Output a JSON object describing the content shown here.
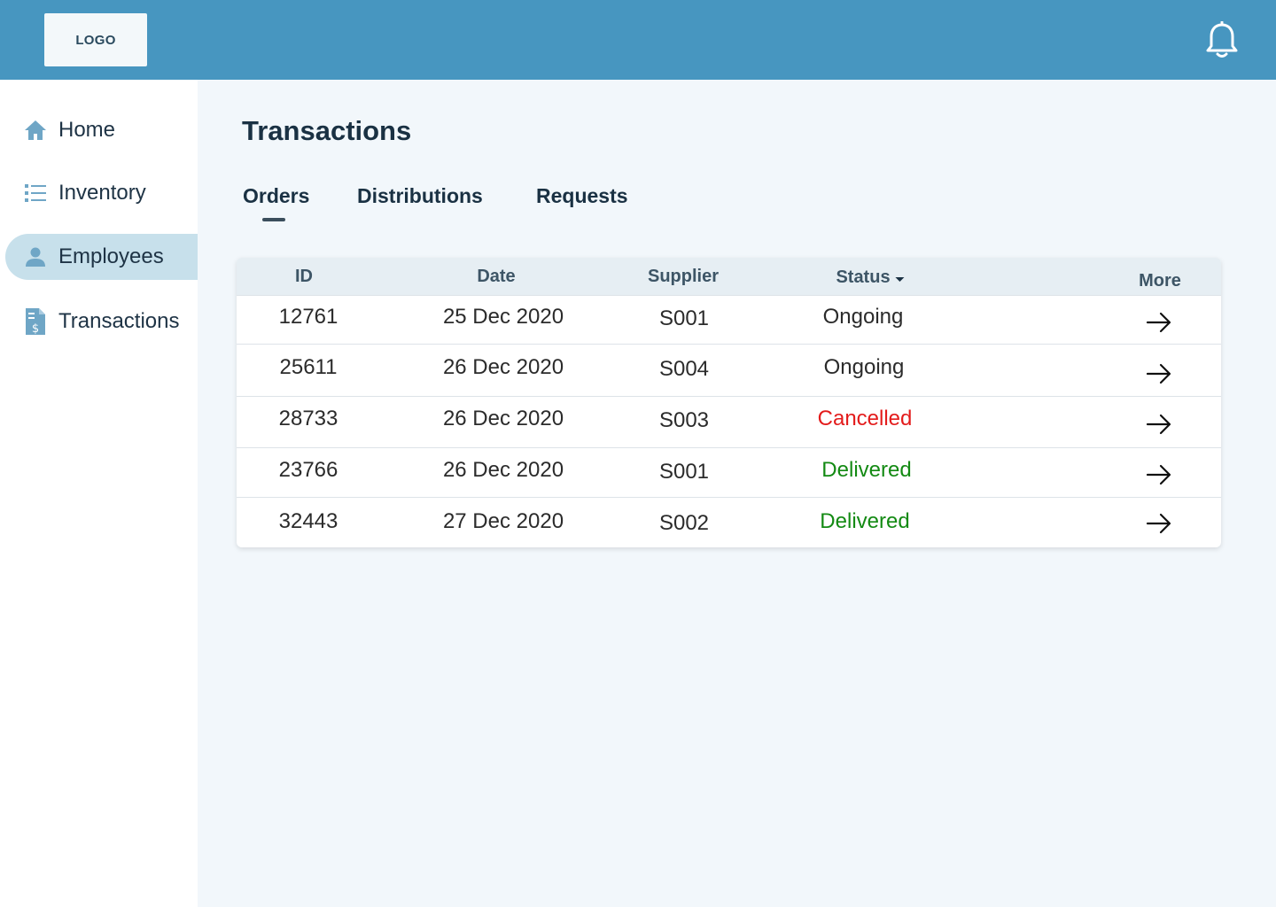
{
  "header": {
    "logo_text": "LOGO",
    "notification_icon": "bell-icon"
  },
  "sidebar": {
    "items": [
      {
        "label": "Home",
        "icon": "home-icon",
        "active": false
      },
      {
        "label": "Inventory",
        "icon": "list-icon",
        "active": false
      },
      {
        "label": "Employees",
        "icon": "person-icon",
        "active": true
      },
      {
        "label": "Transactions",
        "icon": "invoice-icon",
        "active": false
      }
    ]
  },
  "main": {
    "title": "Transactions",
    "tabs": [
      {
        "label": "Orders",
        "active": true
      },
      {
        "label": "Distributions",
        "active": false
      },
      {
        "label": "Requests",
        "active": false
      }
    ],
    "table": {
      "columns": {
        "id": "ID",
        "date": "Date",
        "supplier": "Supplier",
        "status": "Status",
        "more": "More"
      },
      "rows": [
        {
          "id": "12761",
          "date": "25 Dec 2020",
          "supplier": "S001",
          "status": "Ongoing"
        },
        {
          "id": "25611",
          "date": "26 Dec 2020",
          "supplier": "S004",
          "status": "Ongoing"
        },
        {
          "id": "28733",
          "date": "26 Dec 2020",
          "supplier": "S003",
          "status": "Cancelled"
        },
        {
          "id": "23766",
          "date": "26 Dec 2020",
          "supplier": "S001",
          "status": "Delivered"
        },
        {
          "id": "32443",
          "date": "27 Dec 2020",
          "supplier": "S002",
          "status": "Delivered"
        }
      ]
    }
  },
  "colors": {
    "topbar": "#4796c0",
    "active_nav": "#c7e0eb",
    "status_ongoing": "#2b2b2b",
    "status_cancelled": "#e31b1b",
    "status_delivered": "#138a13"
  }
}
